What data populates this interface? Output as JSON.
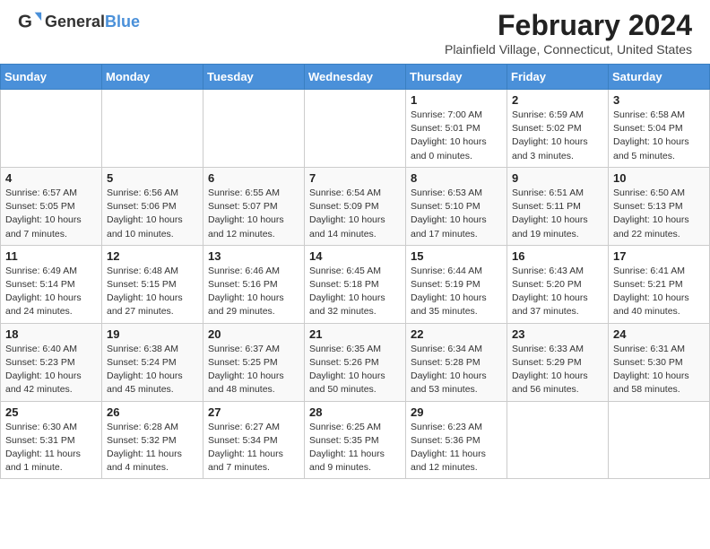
{
  "header": {
    "logo_general": "General",
    "logo_blue": "Blue",
    "month_year": "February 2024",
    "location": "Plainfield Village, Connecticut, United States"
  },
  "days_of_week": [
    "Sunday",
    "Monday",
    "Tuesday",
    "Wednesday",
    "Thursday",
    "Friday",
    "Saturday"
  ],
  "weeks": [
    [
      {
        "day": "",
        "info": ""
      },
      {
        "day": "",
        "info": ""
      },
      {
        "day": "",
        "info": ""
      },
      {
        "day": "",
        "info": ""
      },
      {
        "day": "1",
        "info": "Sunrise: 7:00 AM\nSunset: 5:01 PM\nDaylight: 10 hours\nand 0 minutes."
      },
      {
        "day": "2",
        "info": "Sunrise: 6:59 AM\nSunset: 5:02 PM\nDaylight: 10 hours\nand 3 minutes."
      },
      {
        "day": "3",
        "info": "Sunrise: 6:58 AM\nSunset: 5:04 PM\nDaylight: 10 hours\nand 5 minutes."
      }
    ],
    [
      {
        "day": "4",
        "info": "Sunrise: 6:57 AM\nSunset: 5:05 PM\nDaylight: 10 hours\nand 7 minutes."
      },
      {
        "day": "5",
        "info": "Sunrise: 6:56 AM\nSunset: 5:06 PM\nDaylight: 10 hours\nand 10 minutes."
      },
      {
        "day": "6",
        "info": "Sunrise: 6:55 AM\nSunset: 5:07 PM\nDaylight: 10 hours\nand 12 minutes."
      },
      {
        "day": "7",
        "info": "Sunrise: 6:54 AM\nSunset: 5:09 PM\nDaylight: 10 hours\nand 14 minutes."
      },
      {
        "day": "8",
        "info": "Sunrise: 6:53 AM\nSunset: 5:10 PM\nDaylight: 10 hours\nand 17 minutes."
      },
      {
        "day": "9",
        "info": "Sunrise: 6:51 AM\nSunset: 5:11 PM\nDaylight: 10 hours\nand 19 minutes."
      },
      {
        "day": "10",
        "info": "Sunrise: 6:50 AM\nSunset: 5:13 PM\nDaylight: 10 hours\nand 22 minutes."
      }
    ],
    [
      {
        "day": "11",
        "info": "Sunrise: 6:49 AM\nSunset: 5:14 PM\nDaylight: 10 hours\nand 24 minutes."
      },
      {
        "day": "12",
        "info": "Sunrise: 6:48 AM\nSunset: 5:15 PM\nDaylight: 10 hours\nand 27 minutes."
      },
      {
        "day": "13",
        "info": "Sunrise: 6:46 AM\nSunset: 5:16 PM\nDaylight: 10 hours\nand 29 minutes."
      },
      {
        "day": "14",
        "info": "Sunrise: 6:45 AM\nSunset: 5:18 PM\nDaylight: 10 hours\nand 32 minutes."
      },
      {
        "day": "15",
        "info": "Sunrise: 6:44 AM\nSunset: 5:19 PM\nDaylight: 10 hours\nand 35 minutes."
      },
      {
        "day": "16",
        "info": "Sunrise: 6:43 AM\nSunset: 5:20 PM\nDaylight: 10 hours\nand 37 minutes."
      },
      {
        "day": "17",
        "info": "Sunrise: 6:41 AM\nSunset: 5:21 PM\nDaylight: 10 hours\nand 40 minutes."
      }
    ],
    [
      {
        "day": "18",
        "info": "Sunrise: 6:40 AM\nSunset: 5:23 PM\nDaylight: 10 hours\nand 42 minutes."
      },
      {
        "day": "19",
        "info": "Sunrise: 6:38 AM\nSunset: 5:24 PM\nDaylight: 10 hours\nand 45 minutes."
      },
      {
        "day": "20",
        "info": "Sunrise: 6:37 AM\nSunset: 5:25 PM\nDaylight: 10 hours\nand 48 minutes."
      },
      {
        "day": "21",
        "info": "Sunrise: 6:35 AM\nSunset: 5:26 PM\nDaylight: 10 hours\nand 50 minutes."
      },
      {
        "day": "22",
        "info": "Sunrise: 6:34 AM\nSunset: 5:28 PM\nDaylight: 10 hours\nand 53 minutes."
      },
      {
        "day": "23",
        "info": "Sunrise: 6:33 AM\nSunset: 5:29 PM\nDaylight: 10 hours\nand 56 minutes."
      },
      {
        "day": "24",
        "info": "Sunrise: 6:31 AM\nSunset: 5:30 PM\nDaylight: 10 hours\nand 58 minutes."
      }
    ],
    [
      {
        "day": "25",
        "info": "Sunrise: 6:30 AM\nSunset: 5:31 PM\nDaylight: 11 hours\nand 1 minute."
      },
      {
        "day": "26",
        "info": "Sunrise: 6:28 AM\nSunset: 5:32 PM\nDaylight: 11 hours\nand 4 minutes."
      },
      {
        "day": "27",
        "info": "Sunrise: 6:27 AM\nSunset: 5:34 PM\nDaylight: 11 hours\nand 7 minutes."
      },
      {
        "day": "28",
        "info": "Sunrise: 6:25 AM\nSunset: 5:35 PM\nDaylight: 11 hours\nand 9 minutes."
      },
      {
        "day": "29",
        "info": "Sunrise: 6:23 AM\nSunset: 5:36 PM\nDaylight: 11 hours\nand 12 minutes."
      },
      {
        "day": "",
        "info": ""
      },
      {
        "day": "",
        "info": ""
      }
    ]
  ]
}
